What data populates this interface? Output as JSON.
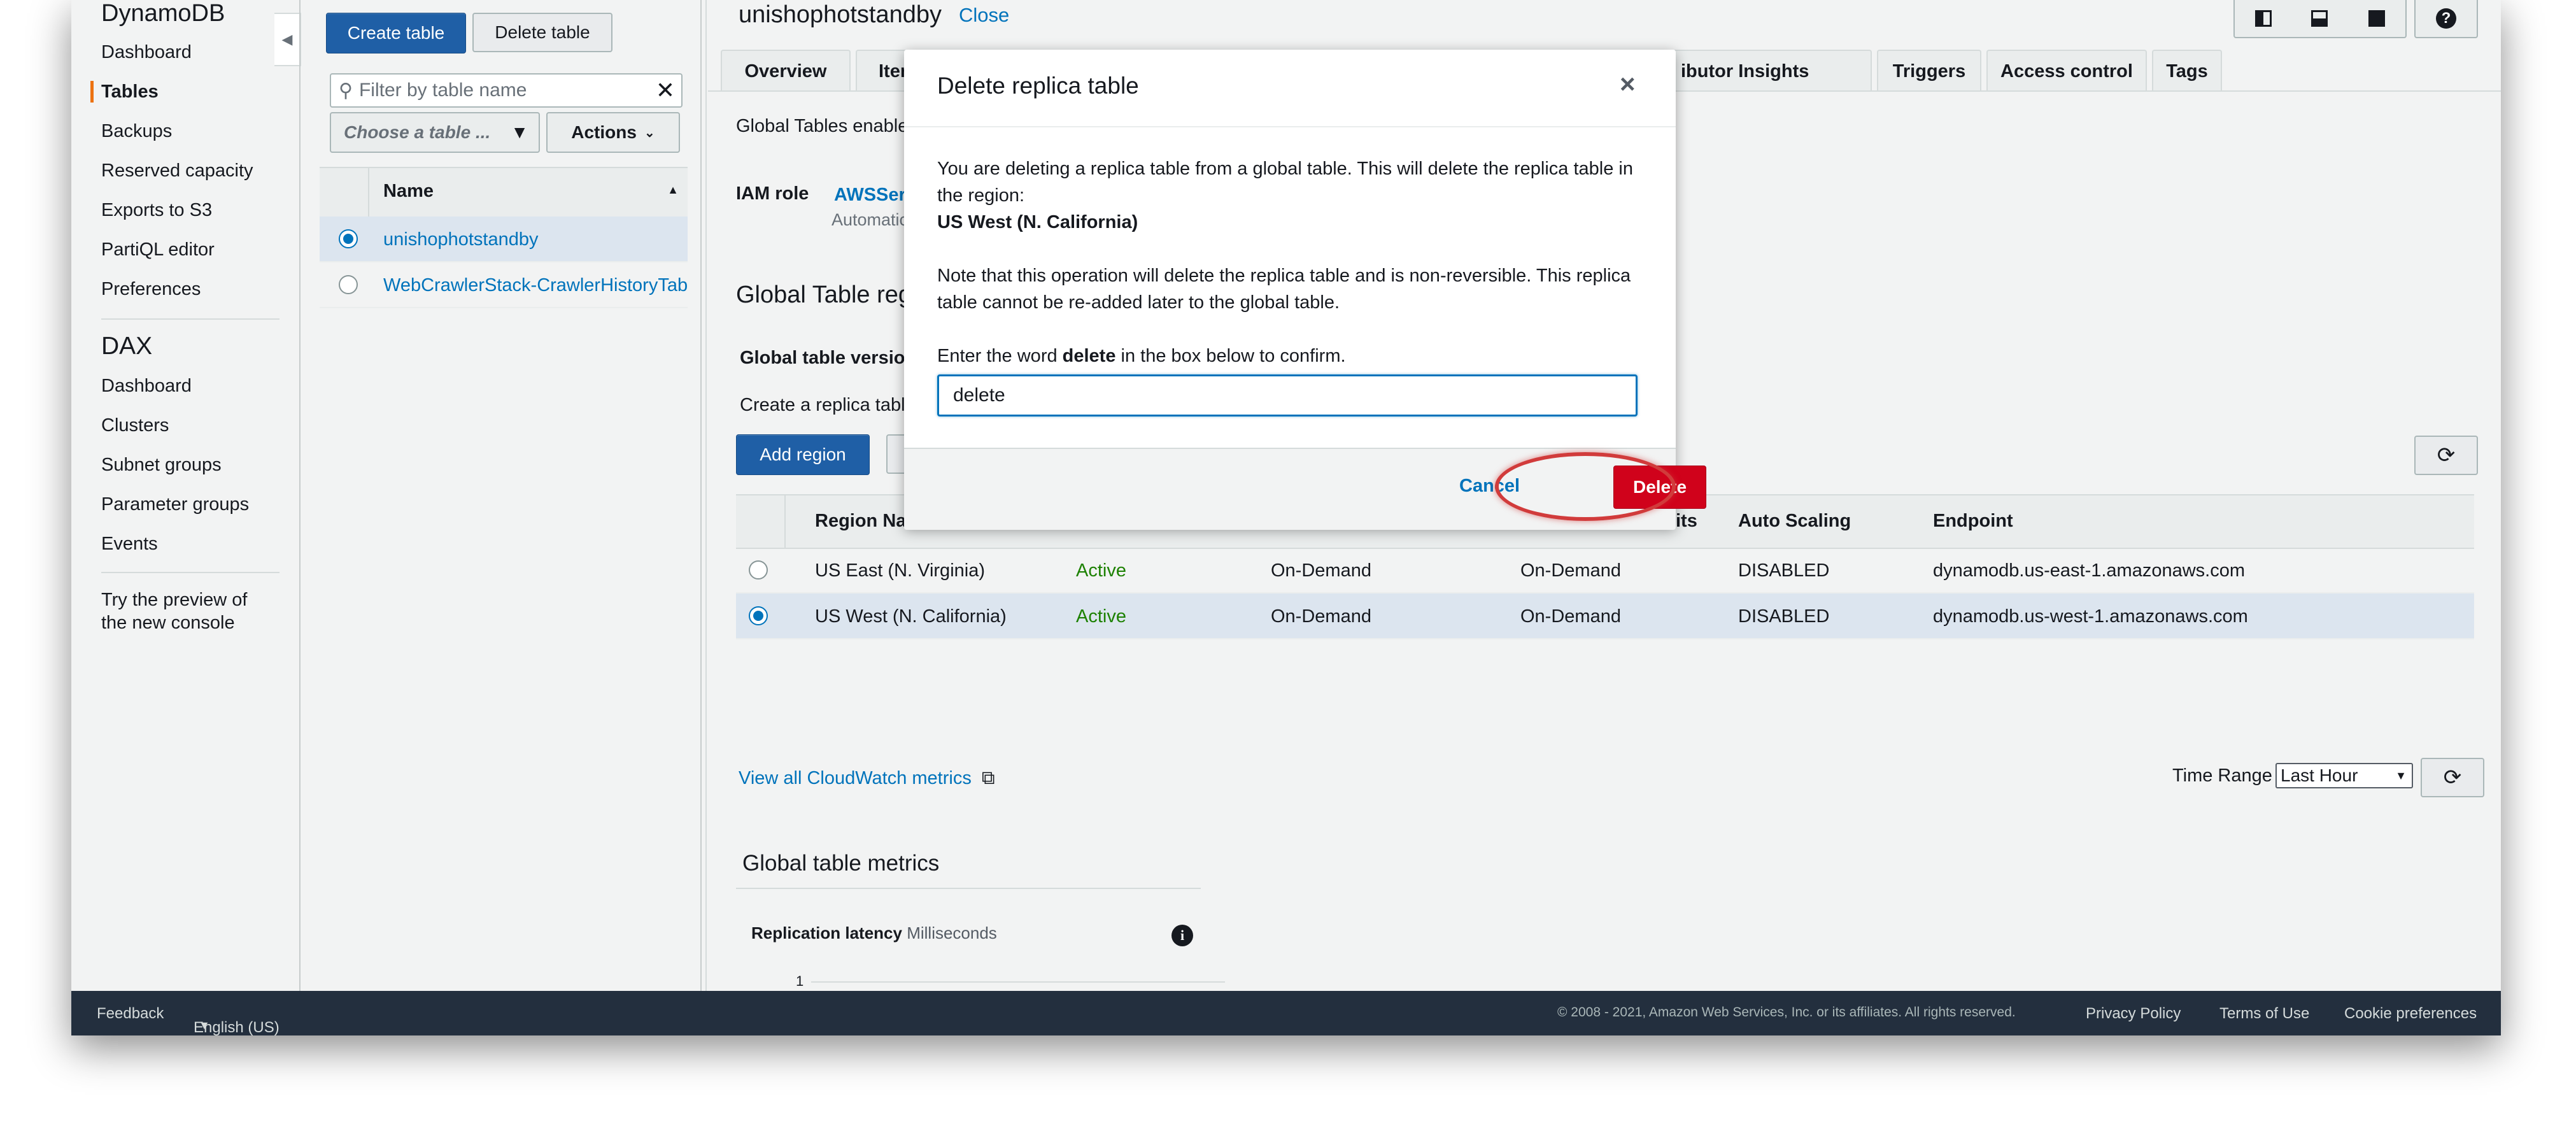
{
  "nav": {
    "service_title": "DynamoDB",
    "items": [
      "Dashboard",
      "Tables",
      "Backups",
      "Reserved capacity",
      "Exports to S3",
      "PartiQL editor",
      "Preferences"
    ],
    "dax_title": "DAX",
    "dax_items": [
      "Dashboard",
      "Clusters",
      "Subnet groups",
      "Parameter groups",
      "Events"
    ],
    "preview_line1": "Try the preview of",
    "preview_line2": "the new console"
  },
  "tables_panel": {
    "create_label": "Create table",
    "delete_label": "Delete table",
    "filter_placeholder": "Filter by table name",
    "choose_label": "Choose a table ...",
    "actions_label": "Actions",
    "column_name": "Name",
    "rows": [
      "unishophotstandby",
      "WebCrawlerStack-CrawlerHistoryTab"
    ]
  },
  "main": {
    "table_name": "unishophotstandby",
    "close_label": "Close",
    "tabs": [
      "Overview",
      "Items",
      "ibutor Insights",
      "Triggers",
      "Access control",
      "Tags"
    ],
    "intro_text": "Global Tables enable",
    "iam_label": "IAM role",
    "iam_value": "AWSSer",
    "iam_sub": "Automatic",
    "section_title": "Global Table regi",
    "version_label": "Global table version",
    "create_replica": "Create a replica table",
    "add_region_label": "Add region",
    "columns": [
      "Region Na",
      "its",
      "Auto Scaling",
      "Endpoint"
    ],
    "regions": [
      {
        "name": "US East (N. Virginia)",
        "status": "Active",
        "read": "On-Demand",
        "write": "On-Demand",
        "scaling": "DISABLED",
        "endpoint": "dynamodb.us-east-1.amazonaws.com"
      },
      {
        "name": "US West (N. California)",
        "status": "Active",
        "read": "On-Demand",
        "write": "On-Demand",
        "scaling": "DISABLED",
        "endpoint": "dynamodb.us-west-1.amazonaws.com"
      }
    ],
    "cloudwatch_link": "View all CloudWatch metrics",
    "time_range_label": "Time Range",
    "time_range_value": "Last Hour",
    "metrics_title": "Global table metrics",
    "latency_label": "Replication latency",
    "latency_unit": "Milliseconds",
    "chart_tick": "1"
  },
  "modal": {
    "title": "Delete replica table",
    "close_glyph": "×",
    "para1": "You are deleting a replica table from a global table. This will delete the replica table in the region:",
    "region": "US West (N. California)",
    "para2": "Note that this operation will delete the replica table and is non-reversible. This replica table cannot be re-added later to the global table.",
    "confirm_prefix": "Enter the word ",
    "confirm_word": "delete",
    "confirm_suffix": " in the box below to confirm.",
    "input_value": "delete",
    "cancel_label": "Cancel",
    "delete_label": "Delete"
  },
  "footer": {
    "feedback": "Feedback",
    "language": "English (US)",
    "copyright": "© 2008 - 2021, Amazon Web Services, Inc. or its affiliates. All rights reserved.",
    "privacy": "Privacy Policy",
    "terms": "Terms of Use",
    "cookies": "Cookie preferences"
  },
  "colors": {
    "primary": "#1f5fa6",
    "danger": "#d0021b",
    "accent_nav": "#ec7211",
    "active_green": "#1d8102",
    "highlight_ring": "#d13b3b"
  }
}
